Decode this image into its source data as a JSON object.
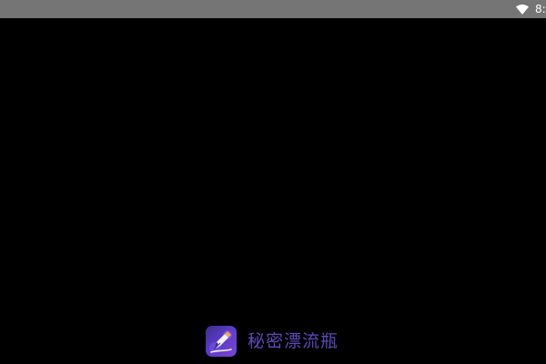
{
  "status_bar": {
    "time": "8:",
    "icons": [
      "wifi-icon"
    ]
  },
  "splash": {
    "app_icon": "quill-pen-icon",
    "app_name": "秘密漂流瓶"
  },
  "colors": {
    "background": "#000000",
    "status_bar": "#757575",
    "app_name": "#5a4bb8",
    "icon_gradient_start": "#3a2d8f",
    "icon_gradient_end": "#7a45d6"
  }
}
